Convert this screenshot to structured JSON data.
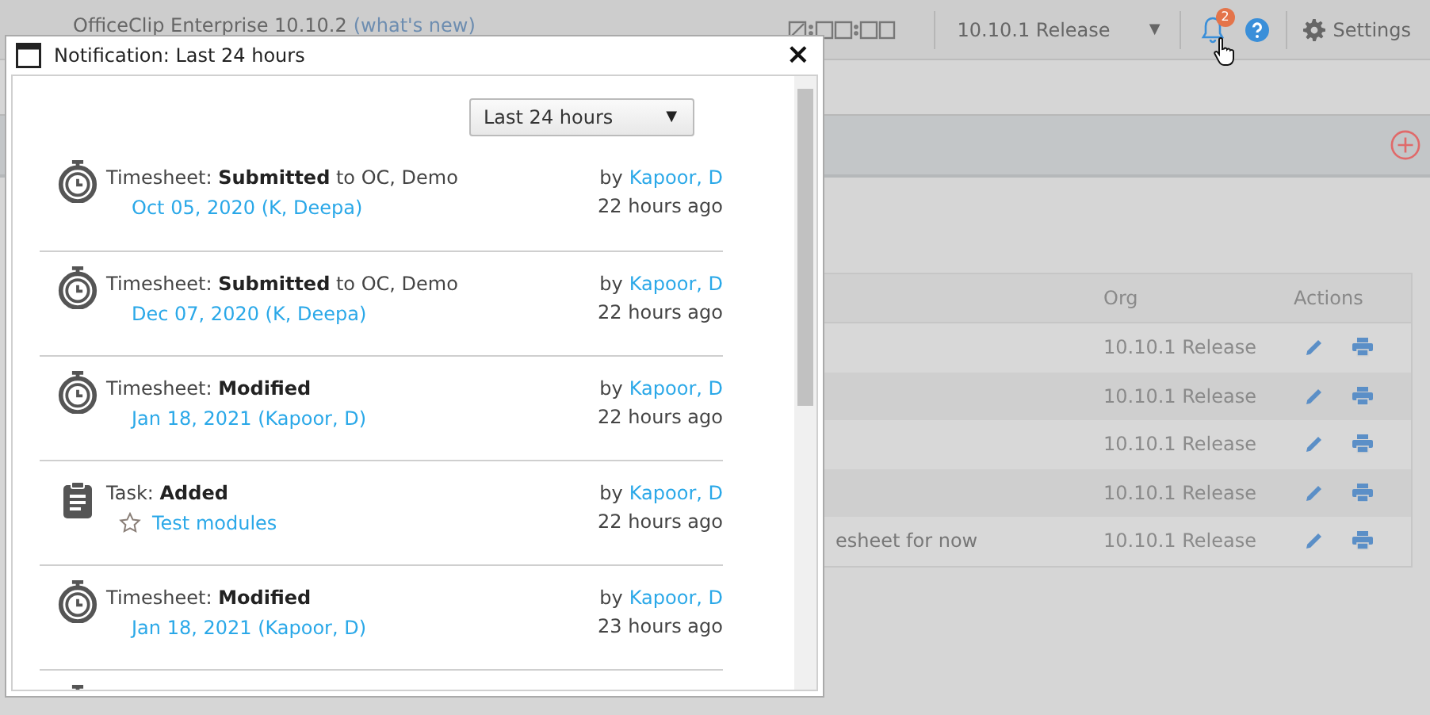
{
  "topbar": {
    "product": "OfficeClip Enterprise 10.10.2",
    "whats_new": "(what's new)",
    "org_select": {
      "value": "10.10.1 Release",
      "caret": "▼"
    },
    "notifications_badge": "2",
    "settings": "Settings"
  },
  "table": {
    "columns": [
      "Org",
      "Actions"
    ],
    "rows": [
      {
        "column_1": "",
        "org": "10.10.1 Release"
      },
      {
        "column_1": "",
        "org": "10.10.1 Release"
      },
      {
        "column_1": "",
        "org": "10.10.1 Release"
      },
      {
        "column_1": "",
        "org": "10.10.1 Release"
      },
      {
        "column_1": "esheet for now",
        "org": "10.10.1 Release"
      }
    ]
  },
  "dialog": {
    "title": "Notification: Last 24 hours",
    "close": "×",
    "filter": {
      "value": "Last 24 hours",
      "caret": "▼"
    },
    "items": [
      {
        "kind": "timesheet",
        "summary": "Timesheet: **Submitted** to OC, Demo",
        "link": "Oct 05, 2020 (K, Deepa)",
        "by": "by",
        "author": "Kapoor, D",
        "time": "22 hours ago"
      },
      {
        "kind": "timesheet",
        "summary": "Timesheet: **Submitted** to OC, Demo",
        "link": "Dec 07, 2020 (K, Deepa)",
        "by": "by",
        "author": "Kapoor, D",
        "time": "22 hours ago"
      },
      {
        "kind": "timesheet",
        "summary": "Timesheet: **Modified**",
        "link": "Jan 18, 2021 (Kapoor, D)",
        "by": "by",
        "author": "Kapoor, D",
        "time": "22 hours ago"
      },
      {
        "kind": "task",
        "summary": "Task: **Added**",
        "link": "Test modules",
        "starred": false,
        "by": "by",
        "author": "Kapoor, D",
        "time": "22 hours ago"
      },
      {
        "kind": "timesheet",
        "summary": "Timesheet: **Modified**",
        "link": "Jan 18, 2021 (Kapoor, D)",
        "by": "by",
        "author": "Kapoor, D",
        "time": "23 hours ago"
      },
      {
        "kind": "timesheet"
      }
    ]
  }
}
